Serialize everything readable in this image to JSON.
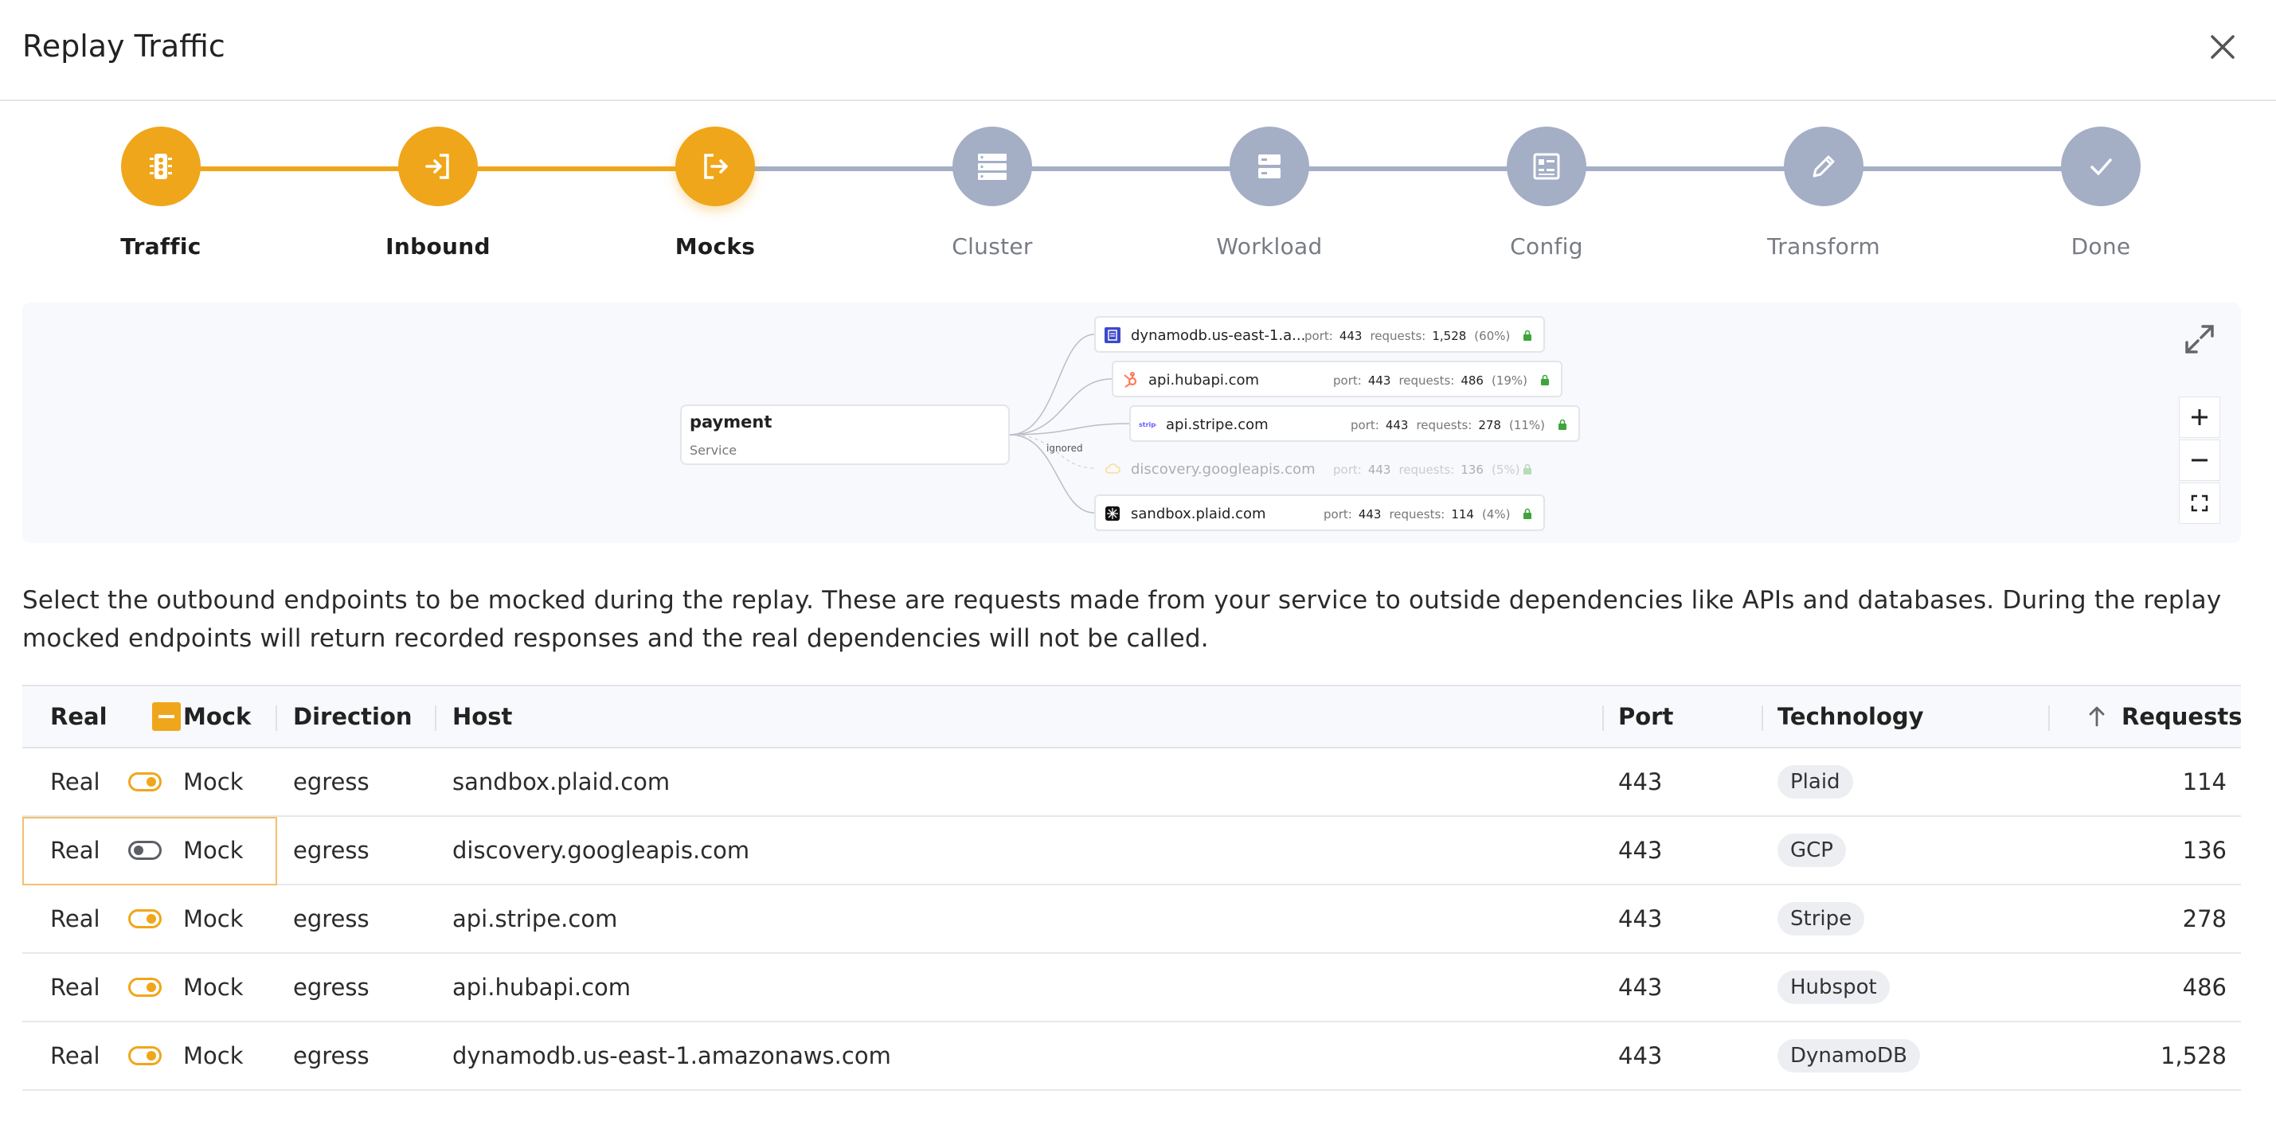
{
  "dialog": {
    "title": "Replay Traffic"
  },
  "colors": {
    "accent": "#f0a61a",
    "inactive": "#a4afc6",
    "panel_bg": "#f8f9fc"
  },
  "stepper": {
    "current": "Mocks",
    "steps": [
      {
        "label": "Traffic",
        "icon": "traffic-light-icon",
        "state": "done"
      },
      {
        "label": "Inbound",
        "icon": "sign-in-icon",
        "state": "done"
      },
      {
        "label": "Mocks",
        "icon": "sign-out-icon",
        "state": "active"
      },
      {
        "label": "Cluster",
        "icon": "server-stack-icon",
        "state": "todo"
      },
      {
        "label": "Workload",
        "icon": "server-icon",
        "state": "todo"
      },
      {
        "label": "Config",
        "icon": "config-list-icon",
        "state": "todo"
      },
      {
        "label": "Transform",
        "icon": "pencil-icon",
        "state": "todo"
      },
      {
        "label": "Done",
        "icon": "check-icon",
        "state": "todo"
      }
    ]
  },
  "graph": {
    "service": {
      "name": "payment",
      "type": "Service"
    },
    "ignored_label": "ignored",
    "port_label": "port:",
    "requests_label": "requests:",
    "endpoints": [
      {
        "host": "dynamodb.us-east-1.a...",
        "port": "443",
        "requests": "1,528",
        "pct": "(60%)",
        "icon": "dynamodb-icon",
        "ignored": false
      },
      {
        "host": "api.hubapi.com",
        "port": "443",
        "requests": "486",
        "pct": "(19%)",
        "icon": "hubspot-icon",
        "ignored": false
      },
      {
        "host": "api.stripe.com",
        "port": "443",
        "requests": "278",
        "pct": "(11%)",
        "icon": "stripe-icon",
        "ignored": false
      },
      {
        "host": "discovery.googleapis.com",
        "port": "443",
        "requests": "136",
        "pct": "(5%)",
        "icon": "gcp-cloud-icon",
        "ignored": true
      },
      {
        "host": "sandbox.plaid.com",
        "port": "443",
        "requests": "114",
        "pct": "(4%)",
        "icon": "plaid-icon",
        "ignored": false
      }
    ]
  },
  "description": "Select the outbound endpoints to be mocked during the replay. These are requests made from your service to outside dependencies like APIs and databases. During the replay mocked endpoints will return recorded responses and the real dependencies will not be called.",
  "table": {
    "headers": {
      "real": "Real",
      "mock": "Mock",
      "direction": "Direction",
      "host": "Host",
      "port": "Port",
      "technology": "Technology",
      "requests": "Requests"
    },
    "sort": {
      "column": "Requests",
      "direction": "ascending"
    },
    "rows": [
      {
        "real": "Real",
        "mock": "Mock",
        "mocked": true,
        "direction": "egress",
        "host": "sandbox.plaid.com",
        "port": "443",
        "technology": "Plaid",
        "requests": "114"
      },
      {
        "real": "Real",
        "mock": "Mock",
        "mocked": false,
        "focused": true,
        "direction": "egress",
        "host": "discovery.googleapis.com",
        "port": "443",
        "technology": "GCP",
        "requests": "136"
      },
      {
        "real": "Real",
        "mock": "Mock",
        "mocked": true,
        "direction": "egress",
        "host": "api.stripe.com",
        "port": "443",
        "technology": "Stripe",
        "requests": "278"
      },
      {
        "real": "Real",
        "mock": "Mock",
        "mocked": true,
        "direction": "egress",
        "host": "api.hubapi.com",
        "port": "443",
        "technology": "Hubspot",
        "requests": "486"
      },
      {
        "real": "Real",
        "mock": "Mock",
        "mocked": true,
        "direction": "egress",
        "host": "dynamodb.us-east-1.amazonaws.com",
        "port": "443",
        "technology": "DynamoDB",
        "requests": "1,528"
      }
    ]
  }
}
